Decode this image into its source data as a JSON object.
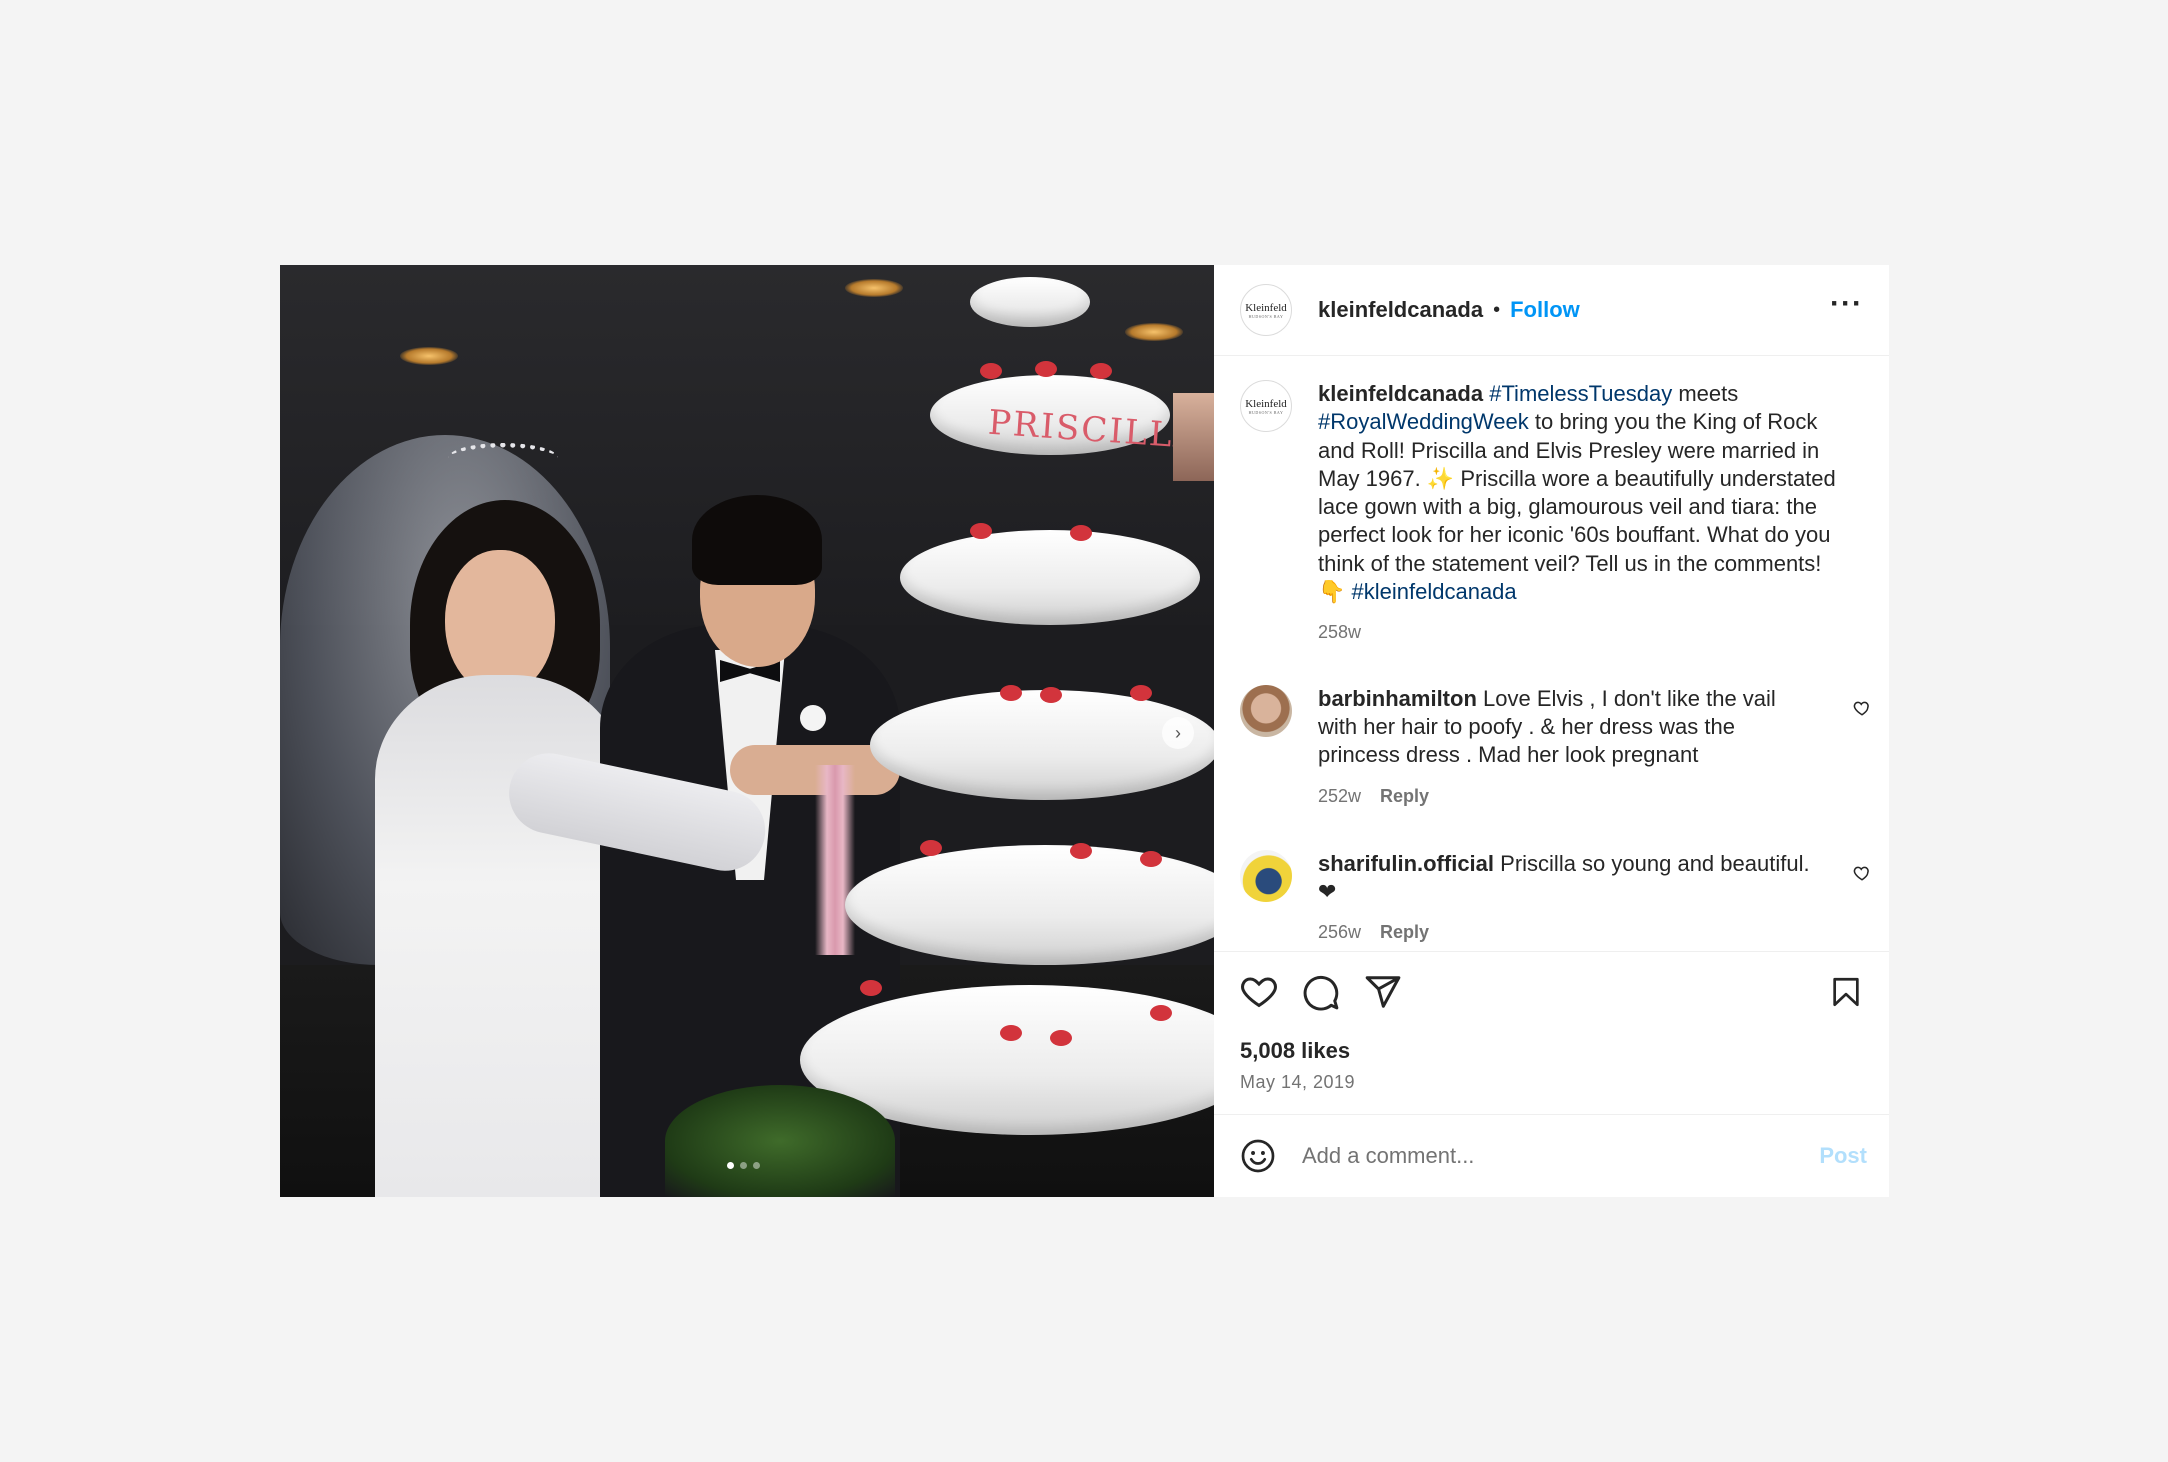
{
  "post": {
    "username": "kleinfeldcanada",
    "follow_label": "Follow",
    "separator": "•",
    "more_label": "···",
    "brand_avatar_text": "Kleinfeld",
    "brand_avatar_subtext": "HUDSON'S BAY",
    "cake_text": "PRISCILLA"
  },
  "caption": {
    "username": "kleinfeldcanada",
    "parts": [
      {
        "text": "#TimelessTuesday",
        "tag": true
      },
      {
        "text": " meets ",
        "tag": false
      },
      {
        "text": "#RoyalWeddingWeek",
        "tag": true
      },
      {
        "text": " to bring you the King of Rock and Roll! Priscilla and Elvis Presley were married in May 1967. ✨ Priscilla wore a beautifully understated lace gown with a big, glamourous veil and tiara: the perfect look for her iconic '60s bouffant. What do you think of the statement veil? Tell us in the comments! 👇 ",
        "tag": false
      },
      {
        "text": "#kleinfeldcanada",
        "tag": true
      }
    ],
    "age": "258w"
  },
  "comments": [
    {
      "username": "barbinhamilton",
      "text": "Love Elvis , I don't like the vail with her hair to poofy . & her dress was the princess dress . Mad her look pregnant",
      "age": "252w",
      "reply_label": "Reply"
    },
    {
      "username": "sharifulin.official",
      "text": "Priscilla so young and beautiful. ❤",
      "age": "256w",
      "reply_label": "Reply"
    }
  ],
  "engagement": {
    "likes": "5,008 likes",
    "date": "May 14, 2019"
  },
  "comment_box": {
    "placeholder": "Add a comment...",
    "post_label": "Post"
  },
  "carousel": {
    "count": 3,
    "active_index": 0
  },
  "colors": {
    "accent": "#0095f6",
    "hashtag": "#00376b",
    "muted": "#737373",
    "post_disabled": "#b2dffc"
  }
}
